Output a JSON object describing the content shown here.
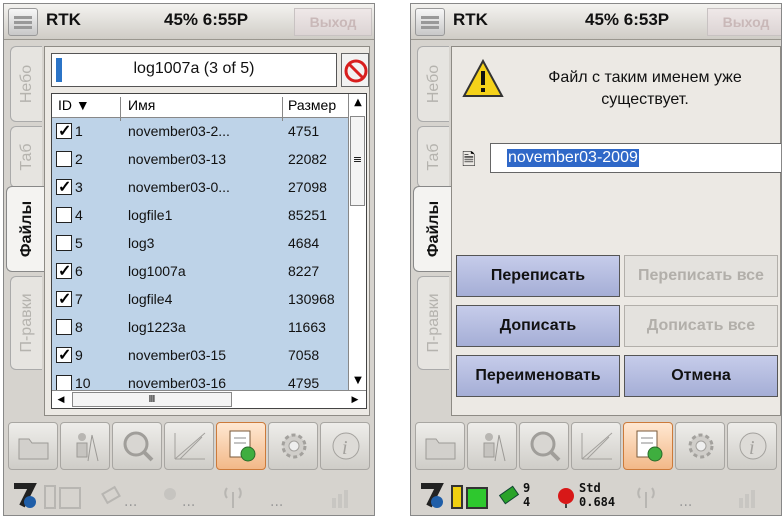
{
  "left": {
    "titlebar": {
      "app": "RTK",
      "status": "45% 6:55P",
      "exit": "Выход"
    },
    "tabs": [
      "Небо",
      "Таб",
      "Файлы",
      "П-равки"
    ],
    "active_tab": "Файлы",
    "file_header": "log1007a (3 of 5)",
    "columns": {
      "id": "ID",
      "name": "Имя",
      "size": "Размер"
    },
    "rows": [
      {
        "checked": true,
        "id": "1",
        "name": "november03-2...",
        "size": "4751"
      },
      {
        "checked": false,
        "id": "2",
        "name": "november03-13",
        "size": "22082"
      },
      {
        "checked": true,
        "id": "3",
        "name": "november03-0...",
        "size": "27098"
      },
      {
        "checked": false,
        "id": "4",
        "name": "logfile1",
        "size": "85251"
      },
      {
        "checked": false,
        "id": "5",
        "name": "log3",
        "size": "4684"
      },
      {
        "checked": true,
        "id": "6",
        "name": "log1007a",
        "size": "8227"
      },
      {
        "checked": true,
        "id": "7",
        "name": "logfile4",
        "size": "130968"
      },
      {
        "checked": false,
        "id": "8",
        "name": "log1223a",
        "size": "11663"
      },
      {
        "checked": true,
        "id": "9",
        "name": "november03-15",
        "size": "7058"
      },
      {
        "checked": false,
        "id": "10",
        "name": "november03-16",
        "size": "4795"
      }
    ]
  },
  "right": {
    "titlebar": {
      "app": "RTK",
      "status": "45% 6:53P",
      "exit": "Выход"
    },
    "tabs": [
      "Небо",
      "Таб",
      "Файлы",
      "П-равки"
    ],
    "active_tab": "Файлы",
    "message": "Файл с таким именем уже существует.",
    "filename": "november03-2009",
    "buttons": {
      "overwrite": "Переписать",
      "overwrite_all": "Переписать все",
      "append": "Дописать",
      "append_all": "Дописать все",
      "rename": "Переименовать",
      "cancel": "Отмена"
    },
    "status": {
      "sats_used": "9",
      "sats_seen": "4",
      "mode": "Std",
      "precision": "0.684"
    }
  },
  "toolbar_icons": [
    "folder-icon",
    "surveyor-icon",
    "magnifier-icon",
    "plot-icon",
    "file-transfer-icon",
    "gear-icon",
    "info-icon"
  ],
  "colors": {
    "selection": "#bed3e8",
    "button": "#aeb6de",
    "highlight": "#2f68c8",
    "active_tool": "#f2b888"
  }
}
